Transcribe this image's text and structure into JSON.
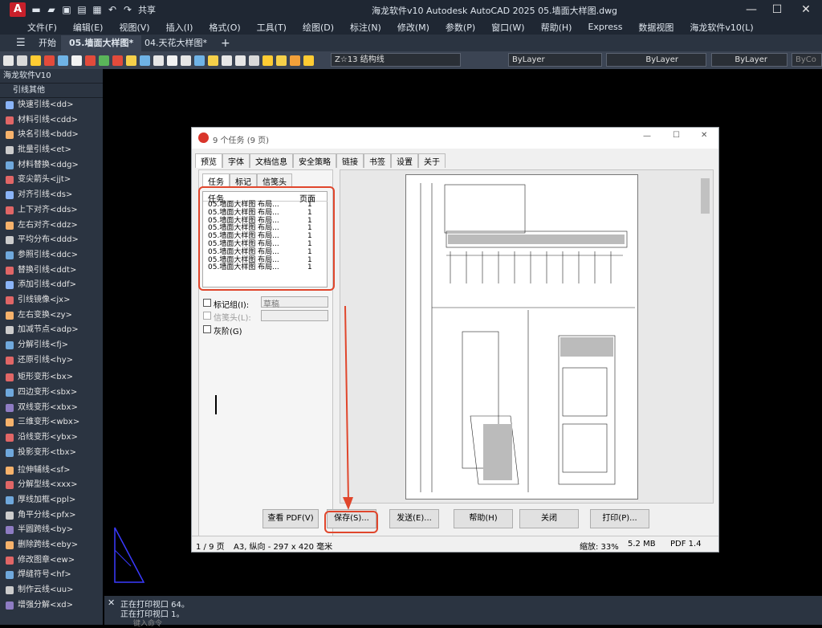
{
  "app": {
    "window_title": "海龙软件v10 Autodesk AutoCAD 2025    05.墙面大样图.dwg",
    "logo": "A",
    "share": "共享"
  },
  "menu": [
    "文件(F)",
    "编辑(E)",
    "视图(V)",
    "插入(I)",
    "格式(O)",
    "工具(T)",
    "绘图(D)",
    "标注(N)",
    "修改(M)",
    "参数(P)",
    "窗口(W)",
    "帮助(H)",
    "Express",
    "数据视图",
    "海龙软件v10(L)"
  ],
  "tabs": {
    "start": "开始",
    "active": "05.墙面大样图*",
    "other": "04.天花大样图*"
  },
  "toolbar": {
    "layer": "Z☆13 结构线",
    "color": "ByLayer",
    "linetype": "ByLayer",
    "lineweight": "ByLayer",
    "plotstyle": "ByCo"
  },
  "panel": {
    "title": "海龙软件V10",
    "section": "引线其他",
    "items": [
      "快速引线<dd>",
      "材料引线<cdd>",
      "块名引线<bdd>",
      "批量引线<et>",
      "材料替换<ddg>",
      "变尖箭头<jjt>",
      "对齐引线<ds>",
      "上下对齐<dds>",
      "左右对齐<ddz>",
      "平均分布<ddd>",
      "参照引线<ddc>",
      "替换引线<ddt>",
      "添加引线<ddf>",
      "引线镜像<jx>",
      "左右变换<zy>",
      "加减节点<adp>",
      "分解引线<fj>",
      "还原引线<hy>"
    ],
    "items2": [
      "矩形变形<bx>",
      "四边变形<sbx>",
      "双线变形<xbx>",
      "三维变形<wbx>",
      "沿线变形<ybx>",
      "投影变形<tbx>"
    ],
    "items3": [
      "拉伸辅线<sf>",
      "分解型线<xxx>",
      "厚线加框<ppl>",
      "角平分线<pfx>",
      "半圆跨线<by>",
      "删除跨线<eby>",
      "修改图章<ew>",
      "焊缝符号<hf>",
      "制作云线<uu>",
      "增强分解<xd>"
    ]
  },
  "dialog": {
    "title": "9 个任务 (9 页)",
    "tabs": [
      "预览",
      "字体",
      "文档信息",
      "安全策略",
      "链接",
      "书签",
      "设置",
      "关于"
    ],
    "subtabs": [
      "任务",
      "标记",
      "信笺头"
    ],
    "task_header": "任务",
    "page_header": "页面",
    "tasks": [
      "05.墙面大样图 布局...",
      "05.墙面大样图 布局...",
      "05.墙面大样图 布局...",
      "05.墙面大样图 布局...",
      "05.墙面大样图 布局...",
      "05.墙面大样图 布局...",
      "05.墙面大样图 布局...",
      "05.墙面大样图 布局...",
      "05.墙面大样图 布局..."
    ],
    "pages": [
      "1",
      "1",
      "1",
      "1",
      "1",
      "1",
      "1",
      "1",
      "1"
    ],
    "mark_group": "标记组(I):",
    "mark_value": "草稿",
    "letterhead": "信笺头(L):",
    "grayscale": "灰阶(G)",
    "buttons": [
      "查看 PDF(V)",
      "保存(S)...",
      "发送(E)...",
      "帮助(H)",
      "关闭",
      "打印(P)..."
    ],
    "status": {
      "page": "1 / 9 页",
      "size": "A3, 纵向 - 297 x 420 毫米",
      "zoom": "缩放: 33%",
      "file": "5.2 MB",
      "pdf": "PDF 1.4"
    }
  },
  "command": {
    "lines": [
      "正在打印视口 64。",
      "正在打印视口 1。"
    ],
    "prompt": "键入命令"
  }
}
